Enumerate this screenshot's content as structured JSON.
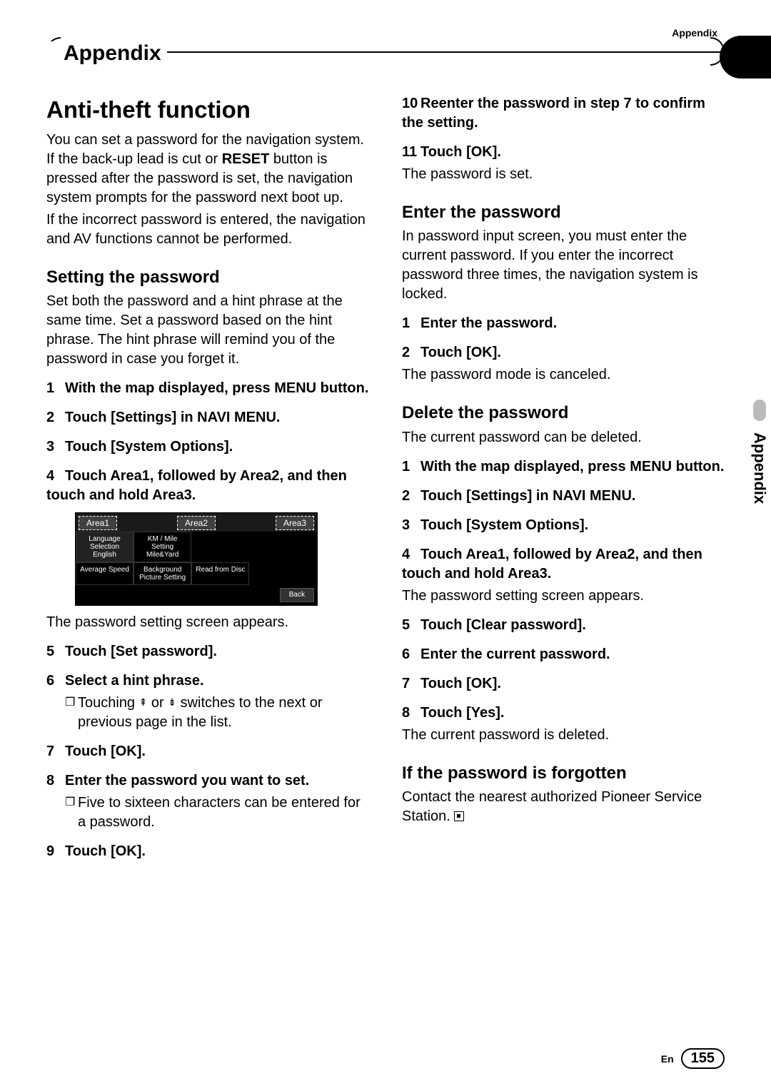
{
  "corner_label": "Appendix",
  "chapter": "Appendix",
  "side_tab": "Appendix",
  "footer": {
    "lang": "En",
    "page": "155"
  },
  "left": {
    "h1": "Anti-theft function",
    "p1": "You can set a password for the navigation system. If the back-up lead is cut or ",
    "p1_bold": "RESET",
    "p1b": " button is pressed after the password is set, the navigation system prompts for the password next boot up.",
    "p2": "If the incorrect password is entered, the navigation and AV functions cannot be performed.",
    "h2a": "Setting the password",
    "p3": "Set both the password and a hint phrase at the same time. Set a password based on the hint phrase. The hint phrase will remind you of the password in case you forget it.",
    "s1": "With the map displayed, press MENU button.",
    "s2": "Touch [Settings] in NAVI MENU.",
    "s3": "Touch [System Options].",
    "s4": "Touch Area1, followed by Area2, and then touch and hold Area3.",
    "p4": "The password setting screen appears.",
    "s5": "Touch [Set password].",
    "s6": "Select a hint phrase.",
    "n6a": "Touching ",
    "n6b": " or ",
    "n6c": " switches to the next or previous page in the list.",
    "s7": "Touch [OK].",
    "s8": "Enter the password you want to set.",
    "n8": "Five to sixteen characters can be entered for a password.",
    "s9": "Touch [OK]."
  },
  "ui": {
    "area1": "Area1",
    "area2": "Area2",
    "area3": "Area3",
    "cells": [
      [
        "Language Selection English",
        "KM / Mile Setting Mile&Yard",
        "",
        ""
      ],
      [
        "Average Speed",
        "Background Picture Setting",
        "Read from Disc",
        ""
      ]
    ],
    "back": "Back"
  },
  "right": {
    "s10": "Reenter the password in step 7 to confirm the setting.",
    "s11": "Touch [OK].",
    "p11": "The password is set.",
    "h2a": "Enter the password",
    "p1": "In password input screen, you must enter the current password. If you enter the incorrect password three times, the navigation system is locked.",
    "e1": "Enter the password.",
    "e2": "Touch [OK].",
    "p2": "The password mode is canceled.",
    "h2b": "Delete the password",
    "p3": "The current password can be deleted.",
    "d1": "With the map displayed, press MENU button.",
    "d2": "Touch [Settings] in NAVI MENU.",
    "d3": "Touch [System Options].",
    "d4": "Touch Area1, followed by Area2, and then touch and hold Area3.",
    "p4": "The password setting screen appears.",
    "d5": "Touch [Clear password].",
    "d6": "Enter the current password.",
    "d7": "Touch [OK].",
    "d8": "Touch [Yes].",
    "p5": "The current password is deleted.",
    "h2c": "If the password is forgotten",
    "p6": "Contact the nearest authorized Pioneer Service Station."
  }
}
